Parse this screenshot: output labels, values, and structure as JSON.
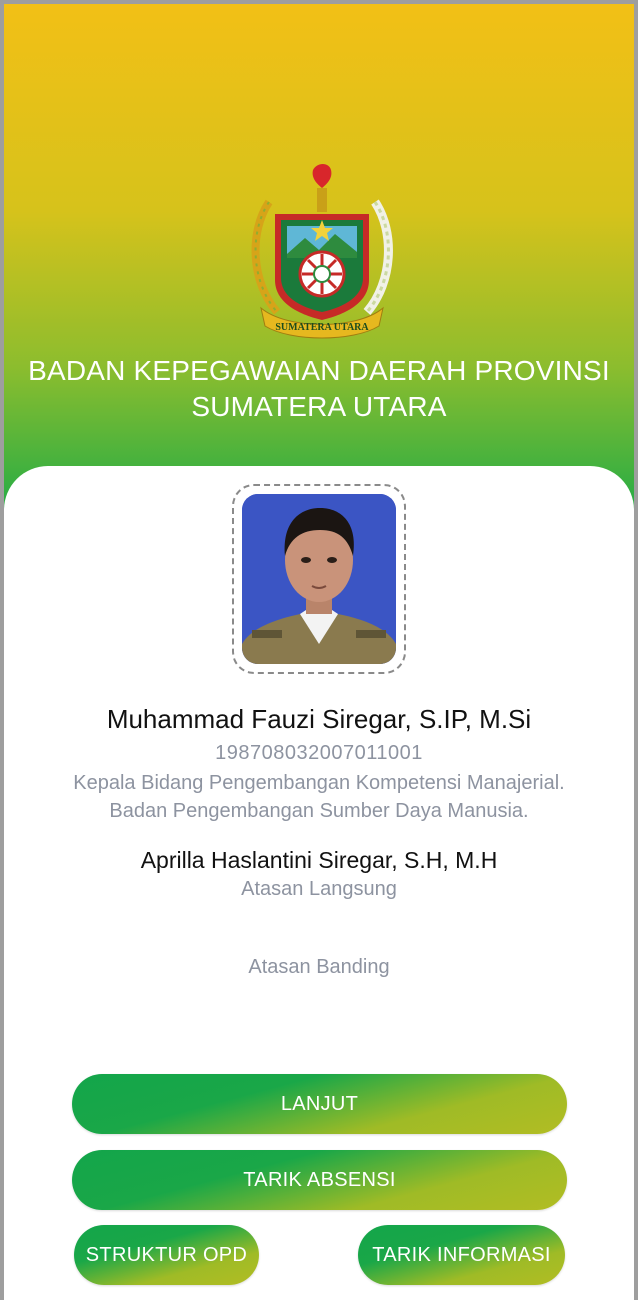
{
  "header": {
    "title_line1": "BADAN KEPEGAWAIAN DAERAH PROVINSI",
    "title_line2": "SUMATERA UTARA",
    "emblem_text": "SUMATERA UTARA"
  },
  "profile": {
    "name": "Muhammad Fauzi Siregar, S.IP, M.Si",
    "nip": "198708032007011001",
    "position": "Kepala Bidang Pengembangan Kompetensi Manajerial.",
    "unit": "Badan Pengembangan Sumber Daya Manusia."
  },
  "supervisor": {
    "name": "Aprilla Haslantini Siregar, S.H, M.H",
    "label": "Atasan Langsung"
  },
  "appeal_supervisor": {
    "label": "Atasan Banding"
  },
  "buttons": {
    "next": "LANJUT",
    "pull_attendance": "TARIK ABSENSI",
    "org_structure": "STRUKTUR OPD",
    "pull_info": "TARIK INFORMASI"
  },
  "colors": {
    "header_top": "#f2c016",
    "header_bottom": "#16a54c",
    "muted_text": "#8d93a0",
    "photo_background": "#3b55c4"
  }
}
